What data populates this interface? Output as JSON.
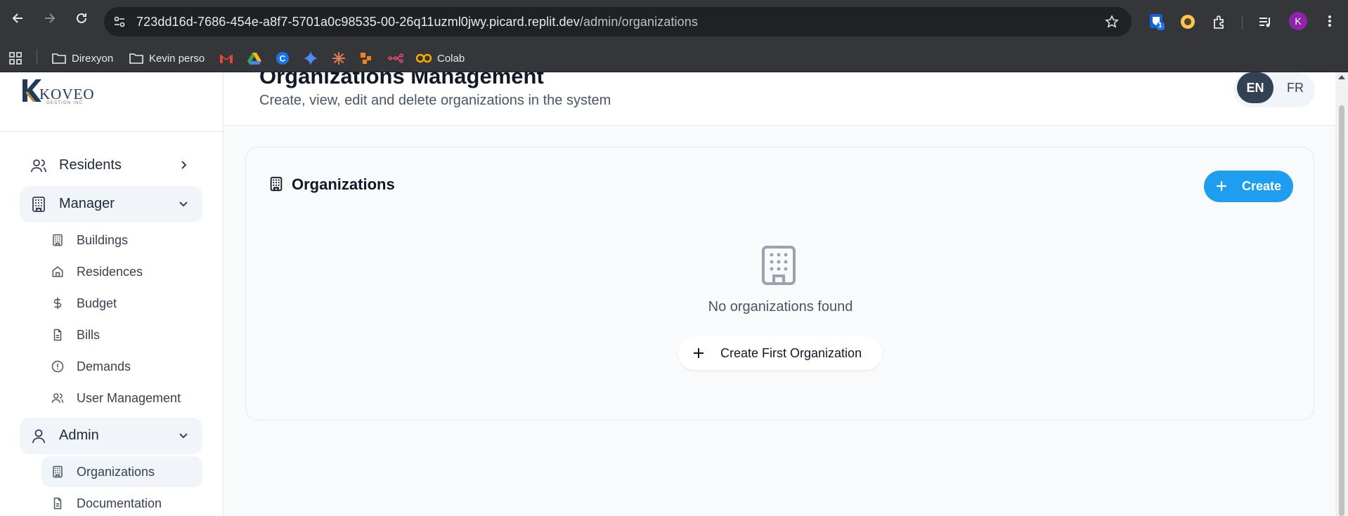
{
  "browser": {
    "url_host": "723dd16d-7686-454e-a8f7-5701a0c98535-00-26q11uzml0jwy.picard.replit.dev",
    "url_path": "/admin/organizations",
    "profile_initial": "K",
    "extension_badge": "1",
    "bookmarks": [
      {
        "label": "Direxyon",
        "icon": "folder-icon"
      },
      {
        "label": "Kevin perso",
        "icon": "folder-icon"
      },
      {
        "label": "",
        "icon": "gmail-icon"
      },
      {
        "label": "",
        "icon": "drive-icon"
      },
      {
        "label": "",
        "icon": "c-icon"
      },
      {
        "label": "",
        "icon": "gemini-icon"
      },
      {
        "label": "",
        "icon": "claude-icon"
      },
      {
        "label": "",
        "icon": "make-icon"
      },
      {
        "label": "",
        "icon": "n8n-icon"
      },
      {
        "label": "Colab",
        "icon": "colab-icon"
      }
    ]
  },
  "brand": {
    "name": "KOVEO",
    "tagline": "GESTION INC"
  },
  "sidebar": {
    "residents": "Residents",
    "manager": "Manager",
    "manager_items": [
      "Buildings",
      "Residences",
      "Budget",
      "Bills",
      "Demands",
      "User Management"
    ],
    "admin": "Admin",
    "admin_items": [
      "Organizations",
      "Documentation"
    ]
  },
  "header": {
    "title": "Organizations Management",
    "subtitle": "Create, view, edit and delete organizations in the system",
    "lang_en": "EN",
    "lang_fr": "FR"
  },
  "card": {
    "title": "Organizations",
    "create_label": "Create",
    "empty_text": "No organizations found",
    "first_label": "Create First Organization"
  },
  "colors": {
    "accent": "#1e9ef0",
    "lang_active": "#334155",
    "chrome": "#35363a"
  }
}
